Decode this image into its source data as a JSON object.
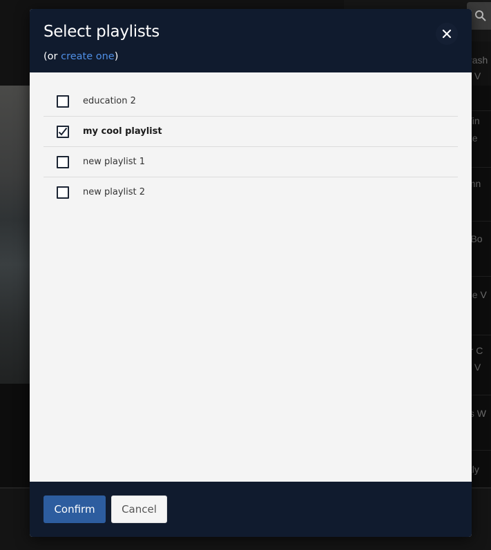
{
  "background": {
    "side_list_fragments": [
      "Crash",
      "ck V",
      "l Tin",
      "ake",
      "umn",
      "A Bo",
      "ose V",
      "ter C",
      "ck V",
      "ins W",
      "okly"
    ]
  },
  "modal": {
    "title": "Select playlists",
    "subtitle_prefix": "(or ",
    "subtitle_link": "create one",
    "subtitle_suffix": ")",
    "close_icon": "close-icon",
    "playlists": [
      {
        "label": "education 2",
        "checked": false
      },
      {
        "label": "my cool playlist",
        "checked": true
      },
      {
        "label": "new playlist 1",
        "checked": false
      },
      {
        "label": "new playlist 2",
        "checked": false
      }
    ],
    "confirm_label": "Confirm",
    "cancel_label": "Cancel"
  },
  "colors": {
    "header_bg": "#101b2e",
    "link": "#4f8fe6",
    "confirm_bg": "#2d5d9f",
    "body_bg": "#f4f4f4"
  }
}
